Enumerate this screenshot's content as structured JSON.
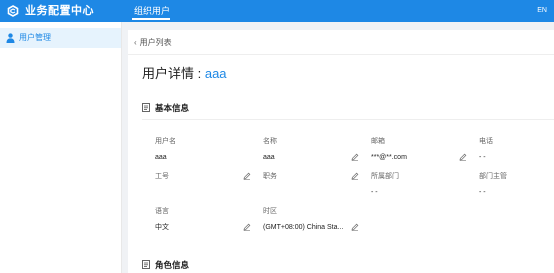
{
  "topbar": {
    "app_title": "业务配置中心",
    "nav_tab": "组织用户",
    "lang": "EN",
    "logo_icon": "app-logo-icon"
  },
  "sidebar": {
    "items": [
      {
        "label": "用户管理",
        "icon": "user-icon",
        "active": true
      }
    ]
  },
  "main": {
    "back_label": "用户列表",
    "title_prefix": "用户详情 : ",
    "title_user": "aaa",
    "sections": {
      "basic": "基本信息",
      "roles": "角色信息"
    },
    "fields": {
      "username": {
        "label": "用户名",
        "value": "aaa"
      },
      "name": {
        "label": "名称",
        "value": "aaa"
      },
      "email": {
        "label": "邮箱",
        "value": "***@**.com"
      },
      "phone": {
        "label": "电话",
        "value": "- -"
      },
      "job_no": {
        "label": "工号",
        "value": ""
      },
      "position": {
        "label": "职务",
        "value": ""
      },
      "department": {
        "label": "所属部门",
        "value": "- -"
      },
      "manager": {
        "label": "部门主管",
        "value": "- -"
      },
      "language": {
        "label": "语言",
        "value": "中文"
      },
      "timezone": {
        "label": "时区",
        "value": "(GMT+08:00) China Sta..."
      }
    }
  },
  "colors": {
    "accent": "#1e88e5",
    "active_bg": "#e6f3fd"
  }
}
